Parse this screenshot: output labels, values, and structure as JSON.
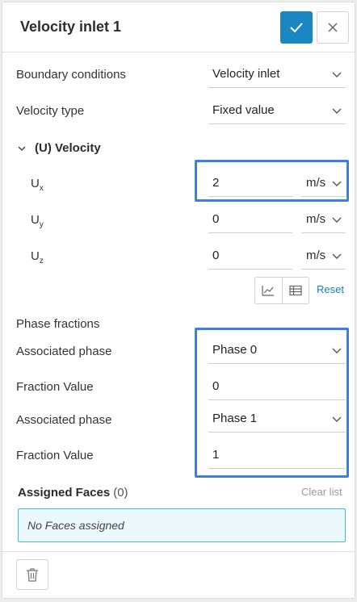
{
  "header": {
    "title": "Velocity inlet 1"
  },
  "boundary_conditions": {
    "label": "Boundary conditions",
    "value": "Velocity inlet"
  },
  "velocity_type": {
    "label": "Velocity type",
    "value": "Fixed value"
  },
  "velocity_section": {
    "title": "(U) Velocity",
    "ux": {
      "label": "U",
      "sub": "x",
      "value": "2",
      "unit": "m/s"
    },
    "uy": {
      "label": "U",
      "sub": "y",
      "value": "0",
      "unit": "m/s"
    },
    "uz": {
      "label": "U",
      "sub": "z",
      "value": "0",
      "unit": "m/s"
    },
    "reset_label": "Reset"
  },
  "phase_fractions": {
    "title": "Phase fractions",
    "rows": [
      {
        "phase_label": "Associated phase",
        "phase_value": "Phase 0",
        "fraction_label": "Fraction Value",
        "fraction_value": "0"
      },
      {
        "phase_label": "Associated phase",
        "phase_value": "Phase 1",
        "fraction_label": "Fraction Value",
        "fraction_value": "1"
      }
    ]
  },
  "assigned_faces": {
    "title": "Assigned Faces",
    "count": "(0)",
    "clear_label": "Clear list",
    "empty_text": "No Faces assigned"
  },
  "colors": {
    "accent": "#1a86c2",
    "highlight": "#3d7fe0",
    "faces_border": "#3fc0cf",
    "faces_bg": "#ecf8fb"
  },
  "icons": [
    "check-icon",
    "close-icon",
    "chevron-down-icon",
    "chart-icon",
    "table-icon",
    "trash-icon"
  ]
}
